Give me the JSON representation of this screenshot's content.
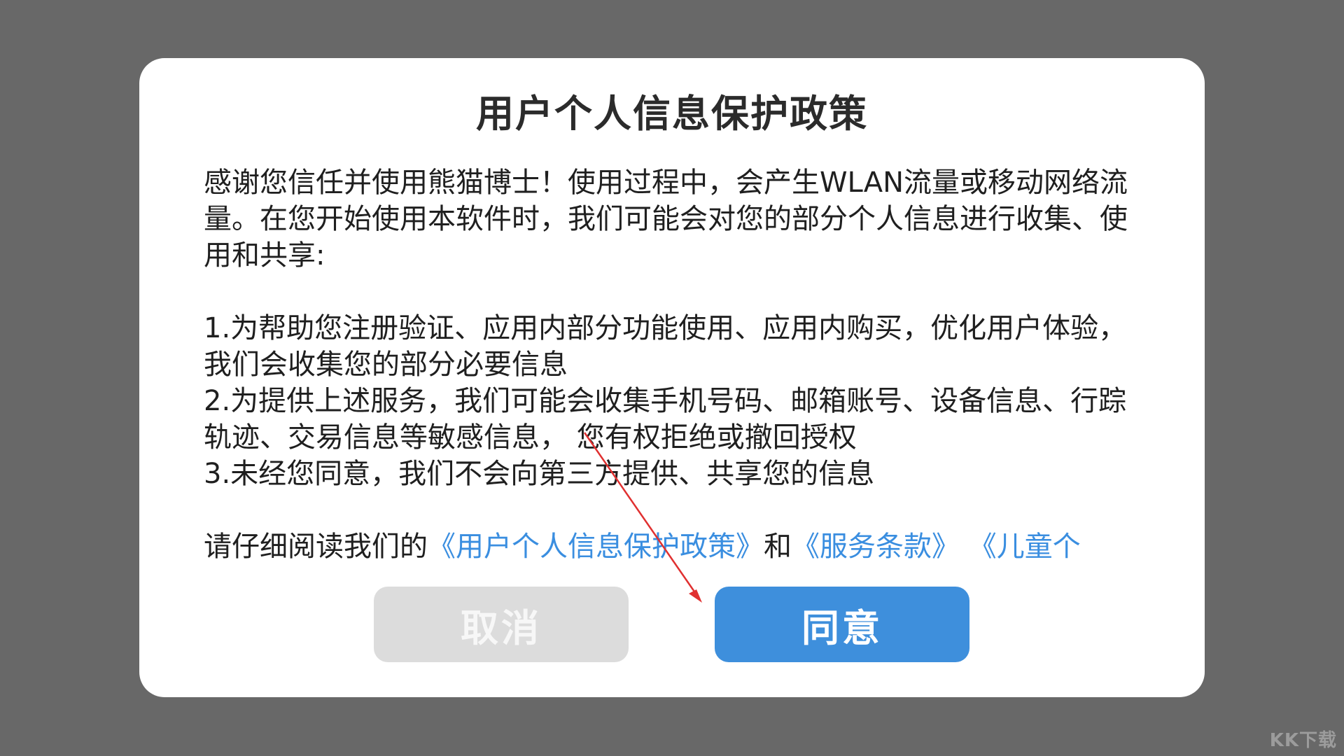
{
  "dialog": {
    "title": "用户个人信息保护政策",
    "intro": "感谢您信任并使用熊猫博士！使用过程中，会产生WLAN流量或移动网络流量。在您开始使用本软件时，我们可能会对您的部分个人信息进行收集、使用和共享:",
    "items": [
      "1.为帮助您注册验证、应用内部分功能使用、应用内购买，优化用户体验，我们会收集您的部分必要信息",
      "2.为提供上述服务，我们可能会收集手机号码、邮箱账号、设备信息、行踪轨迹、交易信息等敏感信息， 您有权拒绝或撤回授权",
      "3.未经您同意，我们不会向第三方提供、共享您的信息"
    ],
    "links_prefix": "请仔细阅读我们的",
    "link_privacy": "《用户个人信息保护政策》",
    "links_and": "和",
    "link_terms": "《服务条款》",
    "link_children": "《儿童个",
    "cancel_label": "取消",
    "agree_label": "同意"
  },
  "watermark": "KK下载",
  "colors": {
    "backdrop": "#686868",
    "agree_button": "#3e8fdc",
    "cancel_button": "#dcdcdc",
    "link": "#3a8ee0",
    "annotation_arrow": "#e03030"
  }
}
